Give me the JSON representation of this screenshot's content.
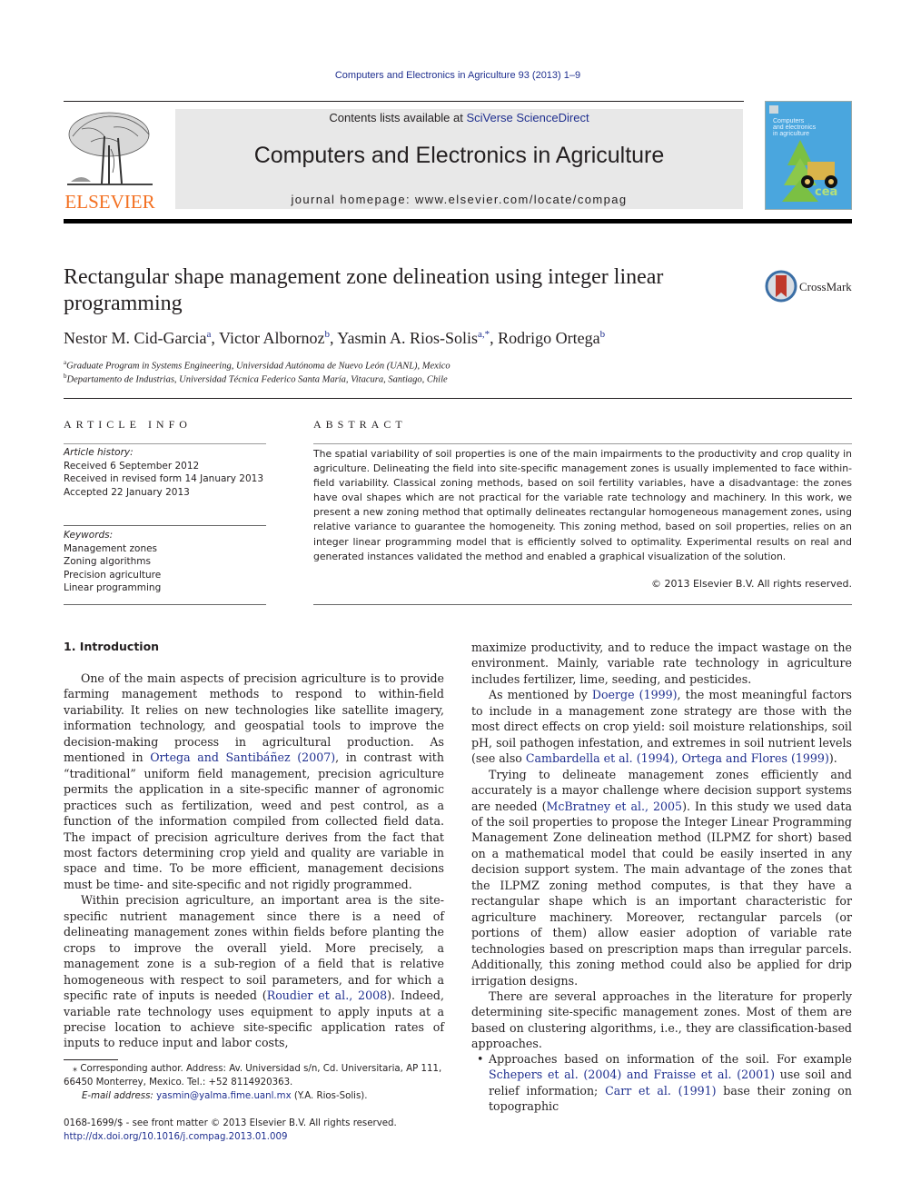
{
  "header": {
    "citation": "Computers and Electronics in Agriculture 93 (2013) 1–9",
    "contents_prefix": "Contents lists available at ",
    "contents_link": "SciVerse ScienceDirect",
    "journal_title": "Computers and Electronics in Agriculture",
    "homepage_prefix": "journal homepage: ",
    "homepage_url": "www.elsevier.com/locate/compag",
    "publisher": "ELSEVIER",
    "cover_text": [
      "Computers",
      "and electronics",
      "in agriculture"
    ],
    "cover_badge": "cea",
    "brand_color": "#f37021",
    "link_color": "#1f2f8f"
  },
  "article": {
    "title": "Rectangular shape management zone delineation using integer linear programming",
    "crossmark_label": "CrossMark",
    "authors": [
      {
        "name": "Nestor M. Cid-Garcia",
        "sup": "a"
      },
      {
        "name": "Victor Albornoz",
        "sup": "b"
      },
      {
        "name": "Yasmin A. Rios-Solis",
        "sup": "a,*"
      },
      {
        "name": "Rodrigo Ortega",
        "sup": "b"
      }
    ],
    "affiliations": [
      {
        "key": "a",
        "text": "Graduate Program in Systems Engineering, Universidad Autónoma de Nuevo León (UANL), Mexico"
      },
      {
        "key": "b",
        "text": "Departamento de Industrias, Universidad Técnica Federico Santa María, Vitacura, Santiago, Chile"
      }
    ]
  },
  "article_info": {
    "heading": "ARTICLE INFO",
    "history_label": "Article history:",
    "history": [
      "Received 6 September 2012",
      "Received in revised form 14 January 2013",
      "Accepted 22 January 2013"
    ],
    "keywords_label": "Keywords:",
    "keywords": [
      "Management zones",
      "Zoning algorithms",
      "Precision agriculture",
      "Linear programming"
    ]
  },
  "abstract": {
    "heading": "ABSTRACT",
    "text": "The spatial variability of soil properties is one of the main impairments to the productivity and crop quality in agriculture. Delineating the field into site-specific management zones is usually implemented to face within-field variability. Classical zoning methods, based on soil fertility variables, have a disadvantage: the zones have oval shapes which are not practical for the variable rate technology and machinery. In this work, we present a new zoning method that optimally delineates rectangular homogeneous management zones, using relative variance to guarantee the homogeneity. This zoning method, based on soil properties, relies on an integer linear programming model that is efficiently solved to optimality. Experimental results on real and generated instances validated the method and enabled a graphical visualization of the solution.",
    "copyright": "© 2013 Elsevier B.V. All rights reserved."
  },
  "body": {
    "section_heading": "1. Introduction",
    "left": {
      "p1_a": "One of the main aspects of precision agriculture is to provide farming management methods to respond to within-field variability. It relies on new technologies like satellite imagery, information technology, and geospatial tools to improve the decision-making process in agricultural production. As mentioned in ",
      "p1_link": "Ortega and Santibáñez (2007)",
      "p1_b": ", in contrast with “traditional” uniform field management, precision agriculture permits the application in a site-specific manner of agronomic practices such as fertilization, weed and pest control, as a function of the information compiled from collected field data. The impact of precision agriculture derives from the fact that most factors determining crop yield and quality are variable in space and time. To be more efficient, management decisions must be time- and site-specific and not rigidly programmed.",
      "p2_a": "Within precision agriculture, an important area is the site-specific nutrient management since there is a need of delineating management zones within fields before planting the crops to improve the overall yield. More precisely, a management zone is a sub-region of a field that is relative homogeneous with respect to soil parameters, and for which a specific rate of inputs is needed (",
      "p2_link": "Roudier et al., 2008",
      "p2_b": "). Indeed, variable rate technology uses equipment to apply inputs at a precise location to achieve site-specific application rates of inputs to reduce input and labor costs,"
    },
    "right": {
      "p0": "maximize productivity, and to reduce the impact wastage on the environment. Mainly, variable rate technology in agriculture includes fertilizer, lime, seeding, and pesticides.",
      "p1_a": "As mentioned by ",
      "p1_link1": "Doerge (1999)",
      "p1_b": ", the most meaningful factors to include in a management zone strategy are those with the most direct effects on crop yield: soil moisture relationships, soil pH, soil pathogen infestation, and extremes in soil nutrient levels (see also ",
      "p1_link2": "Cambardella et al. (1994), Ortega and Flores (1999)",
      "p1_c": ").",
      "p2_a": "Trying to delineate management zones efficiently and accurately is a mayor challenge where decision support systems are needed (",
      "p2_link": "McBratney et al., 2005",
      "p2_b": "). In this study we used data of the soil properties to propose the Integer Linear Programming Management Zone delineation method (ILPMZ for short) based on a mathematical model that could be easily inserted in any decision support system. The main advantage of the zones that the ILPMZ zoning method computes, is that they have a rectangular shape which is an important characteristic for agriculture machinery. Moreover, rectangular parcels (or portions of them) allow easier adoption of variable rate technologies based on prescription maps than irregular parcels. Additionally, this zoning method could also be applied for drip irrigation designs.",
      "p3": "There are several approaches in the literature for properly determining site-specific management zones. Most of them are based on clustering algorithms, i.e., they are classification-based approaches.",
      "bullet_a": "Approaches based on information of the soil. For example ",
      "bullet_link1": "Schepers et al. (2004) and Fraisse et al. (2001)",
      "bullet_b": " use soil and relief information; ",
      "bullet_link2": "Carr et al. (1991)",
      "bullet_c": " base their zoning on topographic"
    }
  },
  "footnotes": {
    "corresponding": "Corresponding author. Address: Av. Universidad s/n, Cd. Universitaria, AP 111, 66450 Monterrey, Mexico. Tel.: +52 8114920363.",
    "star": "⁎",
    "email_label": "E-mail address: ",
    "email": "yasmin@yalma.fime.uanl.mx",
    "email_suffix": " (Y.A. Rios-Solis).",
    "issn": "0168-1699/$ - see front matter © 2013 Elsevier B.V. All rights reserved.",
    "doi": "http://dx.doi.org/10.1016/j.compag.2013.01.009"
  }
}
